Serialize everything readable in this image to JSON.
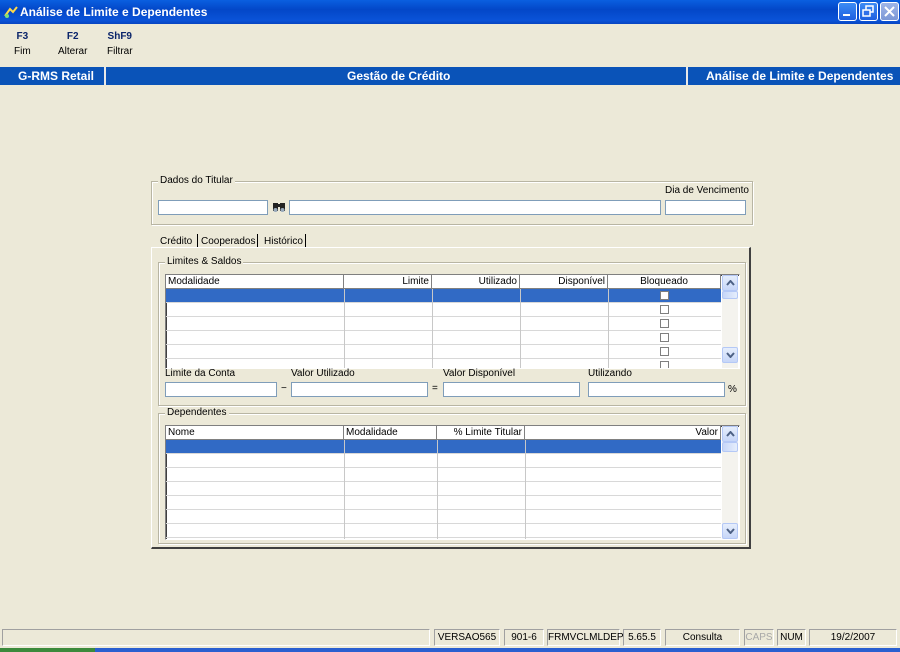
{
  "window": {
    "title": "Análise de Limite e Dependentes",
    "icon": "app-icon"
  },
  "toolbar": {
    "keys": [
      {
        "key": "F3",
        "label": "Fim"
      },
      {
        "key": "F2",
        "label": "Alterar"
      },
      {
        "key": "ShF9",
        "label": "Filtrar"
      }
    ]
  },
  "header": {
    "left": "G-RMS Retail",
    "center": "Gestão de Crédito",
    "right": "Análise de Limite e Dependentes"
  },
  "titular": {
    "legend": "Dados do Titular",
    "code_value": "",
    "name_value": "",
    "due_day_label": "Dia de Vencimento",
    "due_day_value": "",
    "search_icon": "binoculars-icon"
  },
  "tabs": [
    {
      "label": "Crédito"
    },
    {
      "label": "Cooperados"
    },
    {
      "label": "Histórico"
    }
  ],
  "limits": {
    "legend": "Limites & Saldos",
    "columns": [
      "Modalidade",
      "Limite",
      "Utilizado",
      "Disponível",
      "Bloqueado"
    ],
    "rows": [
      {
        "modalidade": "",
        "limite": "",
        "utilizado": "",
        "disponivel": "",
        "bloqueado": false
      },
      {
        "modalidade": "",
        "limite": "",
        "utilizado": "",
        "disponivel": "",
        "bloqueado": false
      },
      {
        "modalidade": "",
        "limite": "",
        "utilizado": "",
        "disponivel": "",
        "bloqueado": false
      },
      {
        "modalidade": "",
        "limite": "",
        "utilizado": "",
        "disponivel": "",
        "bloqueado": false
      },
      {
        "modalidade": "",
        "limite": "",
        "utilizado": "",
        "disponivel": "",
        "bloqueado": false
      }
    ]
  },
  "totals": {
    "limite_label": "Limite da Conta",
    "utilizado_label": "Valor Utilizado",
    "disponivel_label": "Valor Disponível",
    "utilizando_label": "Utilizando",
    "minus": "−",
    "equals": "=",
    "percent": "%",
    "limite_value": "",
    "utilizado_value": "",
    "disponivel_value": "",
    "utilizando_value": ""
  },
  "dependents": {
    "legend": "Dependentes",
    "columns": [
      "Nome",
      "Modalidade",
      "% Limite Titular",
      "Valor"
    ]
  },
  "status": {
    "version": "VERSAO565",
    "code": "901-6",
    "form": "FRMVCLMLDEP",
    "build": "5.65.5",
    "mode": "Consulta",
    "caps": "CAPS",
    "num": "NUM",
    "date": "19/2/2007"
  }
}
